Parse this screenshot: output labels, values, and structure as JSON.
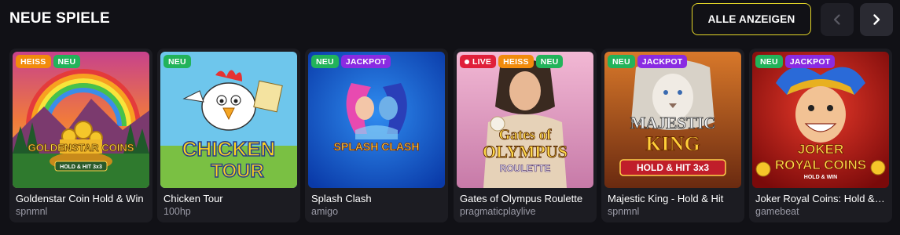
{
  "section": {
    "title": "NEUE SPIELE",
    "show_all_label": "ALLE ANZEIGEN"
  },
  "colors": {
    "accent_border": "#e4d629",
    "badge_heiss": "#f28b0c",
    "badge_neu": "#22b35a",
    "badge_jackpot": "#8a2be2",
    "badge_live": "#e01f3a"
  },
  "games": [
    {
      "title": "Goldenstar Coin Hold & Win",
      "provider": "spnmnl",
      "art_text": "GOLDENSTAR COINS",
      "art_sub": "HOLD & HIT 3x3",
      "badges": [
        {
          "label": "HEISS",
          "kind": "heiss"
        },
        {
          "label": "NEU",
          "kind": "neu"
        }
      ]
    },
    {
      "title": "Chicken Tour",
      "provider": "100hp",
      "art_text": "CHICKEN",
      "art_sub": "TOUR",
      "badges": [
        {
          "label": "NEU",
          "kind": "neu"
        }
      ]
    },
    {
      "title": "Splash Clash",
      "provider": "amigo",
      "art_text": "SPLASH CLASH",
      "art_sub": "",
      "badges": [
        {
          "label": "NEU",
          "kind": "neu"
        },
        {
          "label": "JACKPOT",
          "kind": "jackpot"
        }
      ]
    },
    {
      "title": "Gates of Olympus Roulette",
      "provider": "pragmaticplaylive",
      "art_text": "Gates of",
      "art_sub": "OLYMPUS",
      "art_sub2": "ROULETTE",
      "badges": [
        {
          "label": "LIVE",
          "kind": "live"
        },
        {
          "label": "HEISS",
          "kind": "heiss"
        },
        {
          "label": "NEU",
          "kind": "neu"
        }
      ]
    },
    {
      "title": "Majestic King - Hold & Hit",
      "provider": "spnmnl",
      "art_text": "MAJESTIC",
      "art_sub": "KING",
      "art_sub2": "HOLD & HIT 3x3",
      "badges": [
        {
          "label": "NEU",
          "kind": "neu"
        },
        {
          "label": "JACKPOT",
          "kind": "jackpot"
        }
      ]
    },
    {
      "title": "Joker Royal Coins: Hold & Win",
      "provider": "gamebeat",
      "art_text": "JOKER",
      "art_sub": "ROYAL COINS",
      "art_sub2": "HOLD & WIN",
      "badges": [
        {
          "label": "NEU",
          "kind": "neu"
        },
        {
          "label": "JACKPOT",
          "kind": "jackpot"
        }
      ]
    }
  ]
}
